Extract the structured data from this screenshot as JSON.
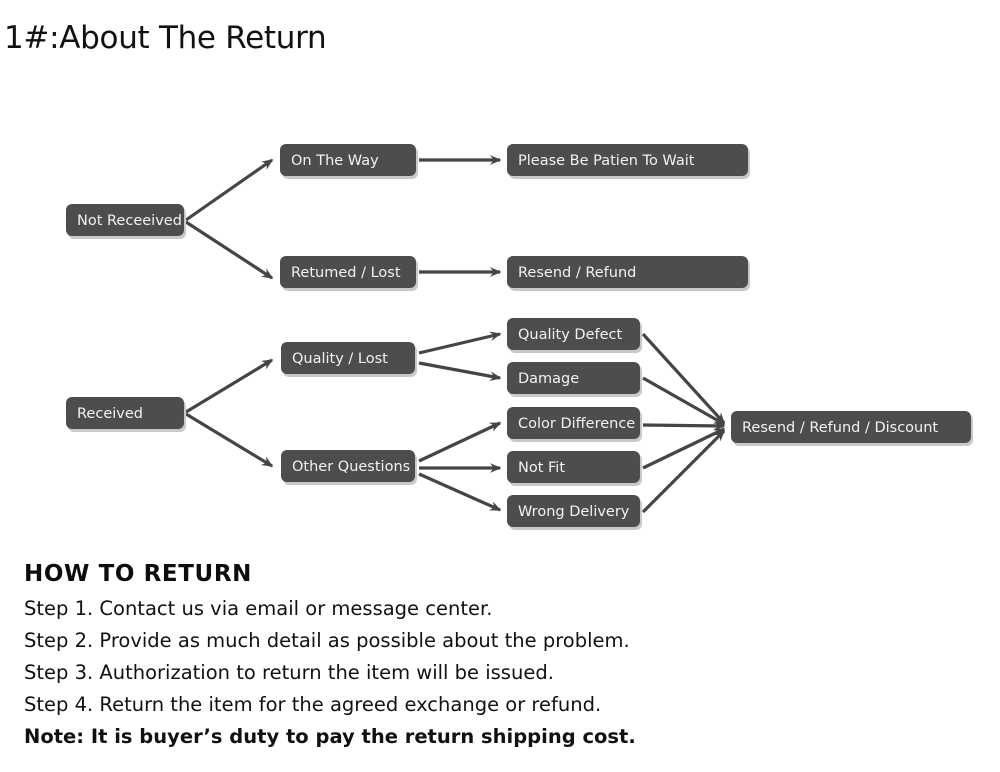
{
  "page": {
    "title": "1#:About The Return",
    "background": "#ffffff",
    "box_color": "#4d4d4d",
    "box_text_color": "#f2f2f2",
    "arrow_color": "#454545"
  },
  "flowchart": {
    "nodes": {
      "not_received": "Not Receeived",
      "on_the_way": "On The Way",
      "returned_lost": "Retumed / Lost",
      "please_wait": "Please Be Patien To Wait",
      "resend_refund": "Resend / Refund",
      "received": "Received",
      "quality_lost": "Quality / Lost",
      "other_questions": "Other Questions",
      "quality_defect": "Quality Defect",
      "damage": "Damage",
      "color_difference": "Color Difference",
      "not_fit": "Not Fit",
      "wrong_delivery": "Wrong Delivery",
      "resend_refund_discount": "Resend / Refund / Discount"
    }
  },
  "howto": {
    "heading": "HOW TO RETURN",
    "steps": [
      "Step 1. Contact us via email or message center.",
      "Step 2. Provide as much detail as possible about the problem.",
      "Step 3. Authorization to return the item will be issued.",
      "Step 4. Return the item for the agreed exchange or refund."
    ],
    "note": "Note: It is buyer’s duty to pay the return shipping cost."
  }
}
